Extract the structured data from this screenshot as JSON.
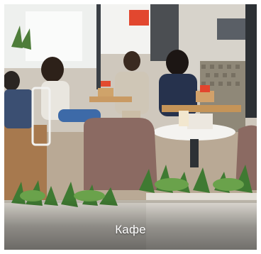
{
  "card": {
    "caption": "Кафе"
  },
  "photo": {
    "icon": "cafe-photo"
  }
}
